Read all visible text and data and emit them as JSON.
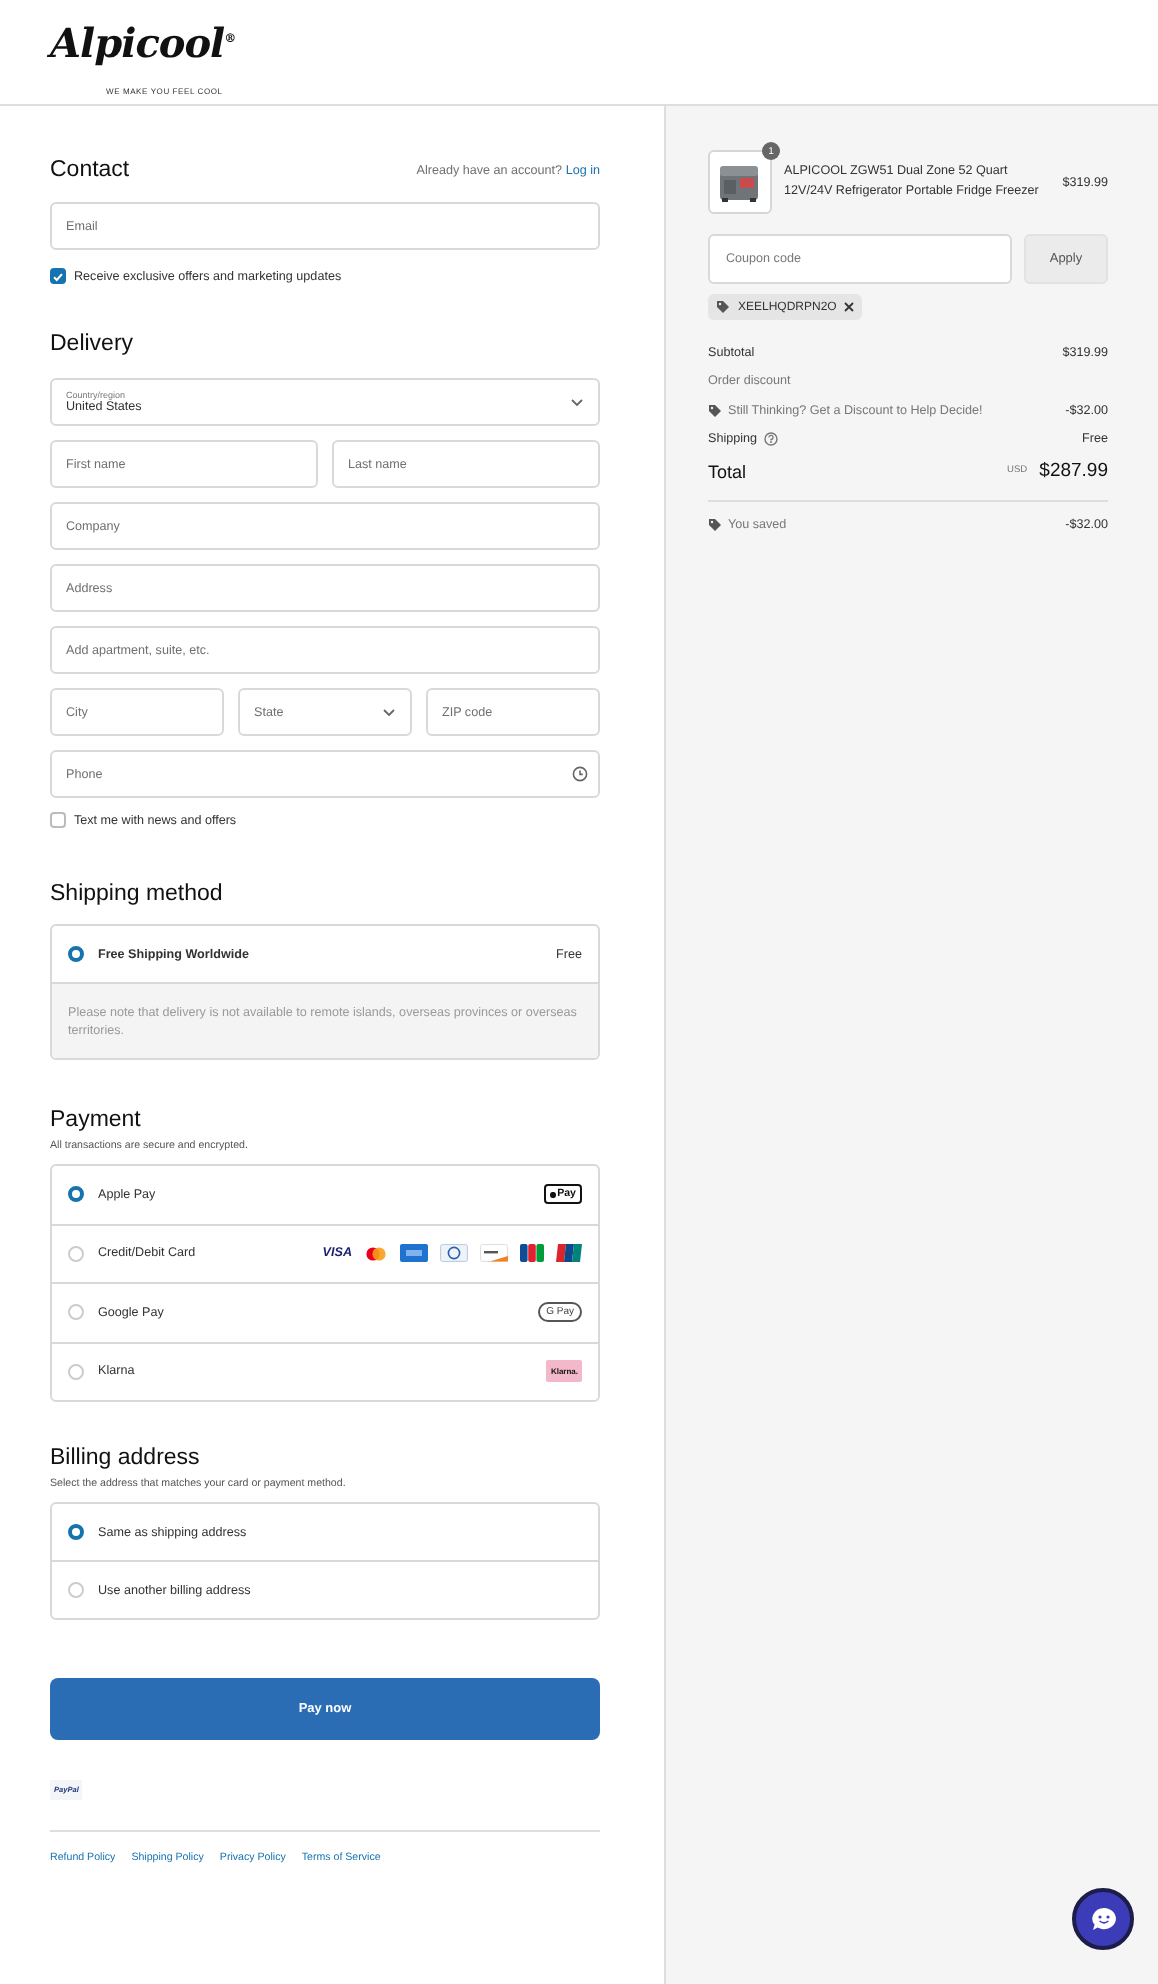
{
  "header": {
    "logo": "Alpicool$^{®}$",
    "tagline": "WE MAKE YOU FEEL COOL"
  },
  "contact": {
    "title": "Contact",
    "login_prompt": "Already have an account?",
    "login_link": "Log in",
    "email": {
      "placeholder": "Email"
    },
    "marketing": {
      "label": "Receive exclusive offers and marketing updates",
      "checked": true
    }
  },
  "delivery": {
    "title": "Delivery",
    "country": {
      "label": "Country/region",
      "value": "United States"
    },
    "rows": [
      {
        "fields": [
          {
            "kind": "input",
            "placeholder": "First name"
          },
          {
            "kind": "input",
            "placeholder": "Last name"
          }
        ]
      },
      {
        "fields": [
          {
            "kind": "input",
            "placeholder": "Company"
          }
        ]
      },
      {
        "fields": [
          {
            "kind": "input",
            "placeholder": "Address"
          }
        ]
      },
      {
        "fields": [
          {
            "kind": "input",
            "placeholder": "Add apartment, suite, etc."
          }
        ]
      },
      {
        "fields": [
          {
            "kind": "input",
            "placeholder": "City"
          },
          {
            "kind": "select",
            "placeholder": "State"
          },
          {
            "kind": "input",
            "placeholder": "ZIP code"
          }
        ]
      },
      {
        "fields": [
          {
            "kind": "phone",
            "placeholder": "Phone"
          }
        ]
      }
    ],
    "sms": {
      "label": "Text me with news and offers",
      "checked": false
    }
  },
  "shipping": {
    "title": "Shipping method",
    "options": [
      {
        "label": "Free Shipping Worldwide",
        "price": "Free",
        "selected": true
      }
    ],
    "note": "Please note that delivery is not available to remote islands, overseas provinces or overseas territories."
  },
  "payment": {
    "title": "Payment",
    "subtitle": "All transactions are secure and encrypted.",
    "options": [
      {
        "label": "Apple Pay",
        "selected": true,
        "badges": [
          {
            "kind": "applepay",
            "text": "Pay"
          }
        ]
      },
      {
        "label": "Credit/Debit Card",
        "selected": false,
        "badges": [
          {
            "kind": "visa",
            "text": "VISA"
          },
          {
            "kind": "mastercard"
          },
          {
            "kind": "amex"
          },
          {
            "kind": "diners"
          },
          {
            "kind": "discover"
          },
          {
            "kind": "jcb"
          },
          {
            "kind": "unionpay"
          }
        ]
      },
      {
        "label": "Google Pay",
        "selected": false,
        "badges": [
          {
            "kind": "gpay",
            "text": "G Pay"
          }
        ]
      },
      {
        "label": "Klarna",
        "selected": false,
        "badges": [
          {
            "kind": "klarna",
            "text": "Klarna."
          }
        ]
      }
    ]
  },
  "billing": {
    "title": "Billing address",
    "subtitle": "Select the address that matches your card or payment method.",
    "options": [
      {
        "label": "Same as shipping address",
        "selected": true
      },
      {
        "label": "Use another billing address",
        "selected": false
      }
    ]
  },
  "pay_button": "Pay now",
  "paypal_badge": "PayPal",
  "footer_links": [
    "Refund Policy",
    "Shipping Policy",
    "Privacy Policy",
    "Terms of Service"
  ],
  "summary": {
    "item": {
      "name": "ALPICOOL ZGW51 Dual Zone 52 Quart 12V/24V Refrigerator Portable Fridge Freezer",
      "quantity": "1",
      "price": "$319.99"
    },
    "coupon": {
      "placeholder": "Coupon code",
      "button": "Apply"
    },
    "applied_code": "XEELHQDRPN2O",
    "subtotal": {
      "label": "Subtotal",
      "value": "$319.99"
    },
    "order_discount": {
      "label": "Order discount"
    },
    "discount_line": {
      "label": "Still Thinking? Get a Discount to Help Decide!",
      "value": "-$32.00"
    },
    "shipping": {
      "label": "Shipping",
      "value": "Free"
    },
    "total": {
      "label": "Total",
      "currency": "USD",
      "value": "$287.99"
    },
    "savings": {
      "label": "You saved",
      "value": "-$32.00"
    }
  }
}
